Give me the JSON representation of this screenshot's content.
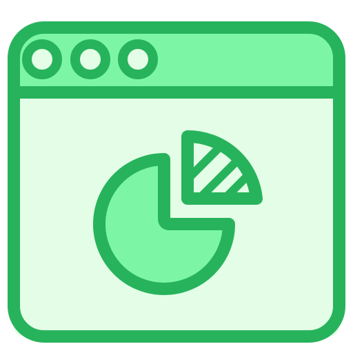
{
  "icon": {
    "name": "browser-window-pie-chart-icon",
    "window_controls": [
      "dot-icon",
      "dot-icon",
      "dot-icon"
    ],
    "colors": {
      "stroke": "#27b35c",
      "titlebar_fill": "#7cf6a5",
      "content_fill": "#e3fde6",
      "dot_fill": "#e3fde6",
      "pie_main_fill": "#7cf6a5",
      "pie_slice_fill": "#e3fde6",
      "hatch": "#27b35c"
    }
  }
}
